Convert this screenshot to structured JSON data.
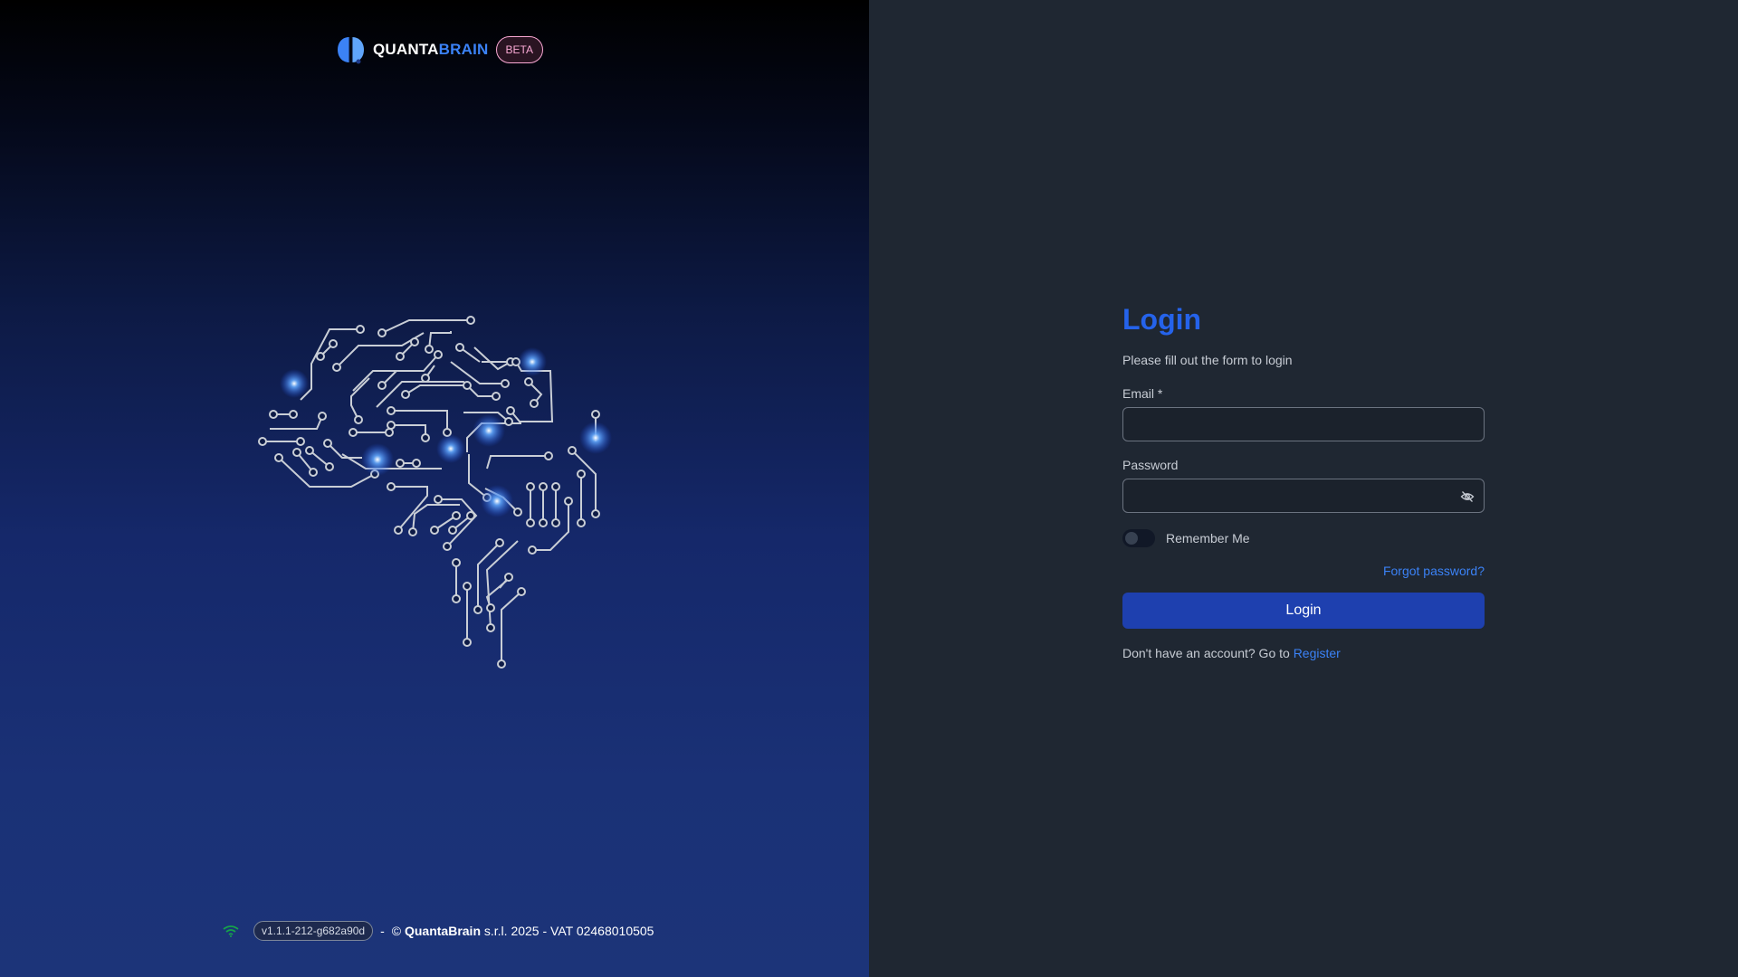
{
  "brand": {
    "name_part1": "QUANTA",
    "name_part2": "BRAIN",
    "badge": "BETA",
    "logo_icon": "brain-logo-icon",
    "accent_color": "#3b82f6"
  },
  "illustration": {
    "icon": "circuit-brain-icon"
  },
  "footer": {
    "status_icon": "wifi-icon",
    "status_color": "#16a34a",
    "version": "v1.1.1-212-g682a90d",
    "separator": "-",
    "copyright_prefix": "©",
    "company": "QuantaBrain",
    "copyright_suffix": "s.r.l. 2025 - VAT 02468010505"
  },
  "login": {
    "title": "Login",
    "subtitle": "Please fill out the form to login",
    "email_label": "Email *",
    "email_value": "",
    "password_label": "Password",
    "password_value": "",
    "password_toggle_icon": "eye-off-icon",
    "remember_label": "Remember Me",
    "remember_checked": false,
    "forgot_link": "Forgot password?",
    "submit_label": "Login",
    "register_prompt": "Don't have an account? Go to",
    "register_link": "Register",
    "primary_color": "#1e40af",
    "link_color": "#3b82f6"
  }
}
